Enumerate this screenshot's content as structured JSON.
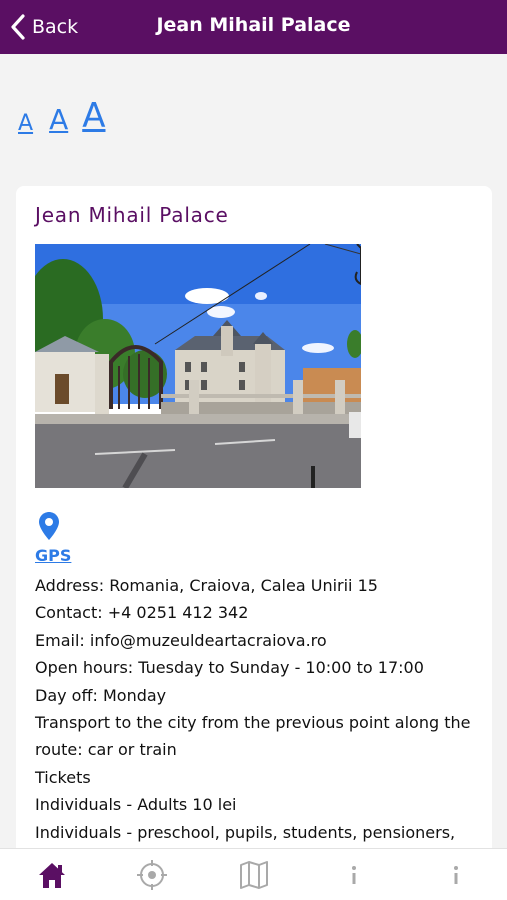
{
  "header": {
    "back_label": "Back",
    "title": "Jean Mihail Palace"
  },
  "font_controls": {
    "small": "A",
    "medium": "A",
    "large": "A"
  },
  "card": {
    "title": "Jean Mihail Palace",
    "gps_label": "GPS",
    "lines": [
      "Address: Romania, Craiova, Calea Unirii 15",
      "Contact: +4 0251 412 342",
      "Email: info@muzeuldeartacraiova.ro",
      "Open hours: Tuesday to Sunday - 10:00 to 17:00",
      "Day off: Monday",
      "Transport to the city from the previous point along the route: car or train",
      "Tickets",
      "Individuals - Adults 10 lei",
      "Individuals - preschool, pupils, students, pensioners,"
    ]
  },
  "tabbar": {
    "items": [
      {
        "icon": "home-icon",
        "active": true
      },
      {
        "icon": "target-icon",
        "active": false
      },
      {
        "icon": "map-icon",
        "active": false
      },
      {
        "icon": "info-icon",
        "active": false
      },
      {
        "icon": "info-icon",
        "active": false
      }
    ]
  },
  "colors": {
    "brand": "#5a0f63",
    "link": "#2d7be6",
    "inactive_icon": "#a9a9a9"
  }
}
